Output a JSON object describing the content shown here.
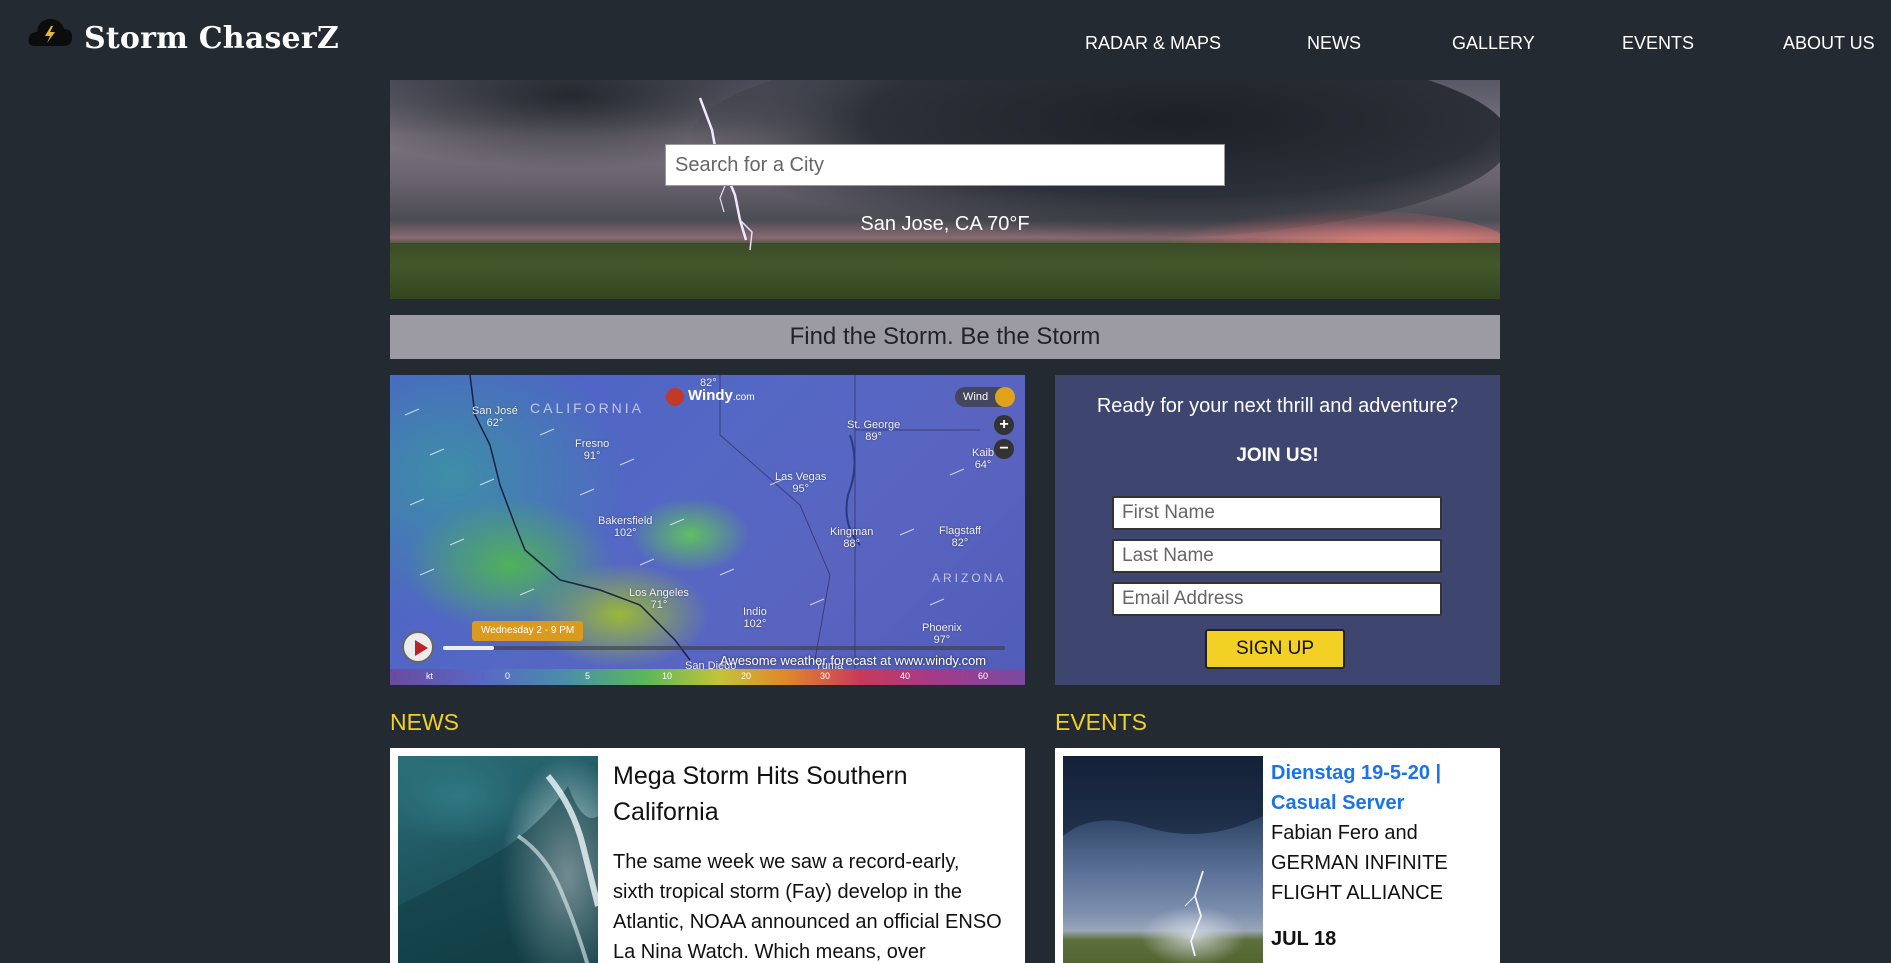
{
  "header": {
    "brand": "Storm ChaserZ",
    "logo_icon": "lightning-bolt",
    "nav": [
      {
        "label": "RADAR & MAPS"
      },
      {
        "label": "NEWS"
      },
      {
        "label": "GALLERY"
      },
      {
        "label": "EVENTS"
      },
      {
        "label": "ABOUT US"
      }
    ]
  },
  "hero": {
    "search_placeholder": "Search for a City",
    "location": "San Jose, CA 70°F"
  },
  "tagline": "Find the Storm. Be the Storm",
  "map": {
    "brand": "Windy",
    "brand_suffix": "com",
    "layer": "Wind",
    "zoom_in": "+",
    "zoom_out": "−",
    "regions": [
      "CALIFORNIA",
      "ARIZONA"
    ],
    "cities": [
      {
        "name": "San José",
        "temp": "62°"
      },
      {
        "name": "",
        "temp": "82°"
      },
      {
        "name": "Fresno",
        "temp": "91°"
      },
      {
        "name": "St. George",
        "temp": "89°"
      },
      {
        "name": "Kaib",
        "temp": "64°"
      },
      {
        "name": "Las Vegas",
        "temp": "95°"
      },
      {
        "name": "Bakersfield",
        "temp": "102°"
      },
      {
        "name": "Kingman",
        "temp": "88°"
      },
      {
        "name": "Flagstaff",
        "temp": "82°"
      },
      {
        "name": "Los Angeles",
        "temp": "71°"
      },
      {
        "name": "Indio",
        "temp": "102°"
      },
      {
        "name": "Phoenix",
        "temp": "97°"
      },
      {
        "name": "San Diego",
        "temp": ""
      },
      {
        "name": "Yuma",
        "temp": ""
      }
    ],
    "time_label": "Wednesday 2 - 9 PM",
    "timeline_progress": 0.09,
    "credit": "Awesome weather forecast at www.windy.com",
    "scale_unit": "kt",
    "scale_values": [
      "0",
      "5",
      "10",
      "20",
      "30",
      "40",
      "60"
    ]
  },
  "signup": {
    "prompt": "Ready for your next thrill and adventure?",
    "join": "JOIN US!",
    "first_name_placeholder": "First Name",
    "last_name_placeholder": "Last Name",
    "email_placeholder": "Email Address",
    "button": "SIGN UP"
  },
  "news": {
    "heading": "NEWS",
    "title": "Mega Storm Hits Southern California",
    "body": "The same week we saw a record-early, sixth tropical storm (Fay) develop in the Atlantic, NOAA announced an official ENSO La Nina Watch. Which means, over"
  },
  "events": {
    "heading": "EVENTS",
    "link": "Dienstag 19-5-20 | Casual Server",
    "description": "Fabian Fero and GERMAN INFINITE FLIGHT ALLIANCE",
    "date": "JUL 18"
  }
}
